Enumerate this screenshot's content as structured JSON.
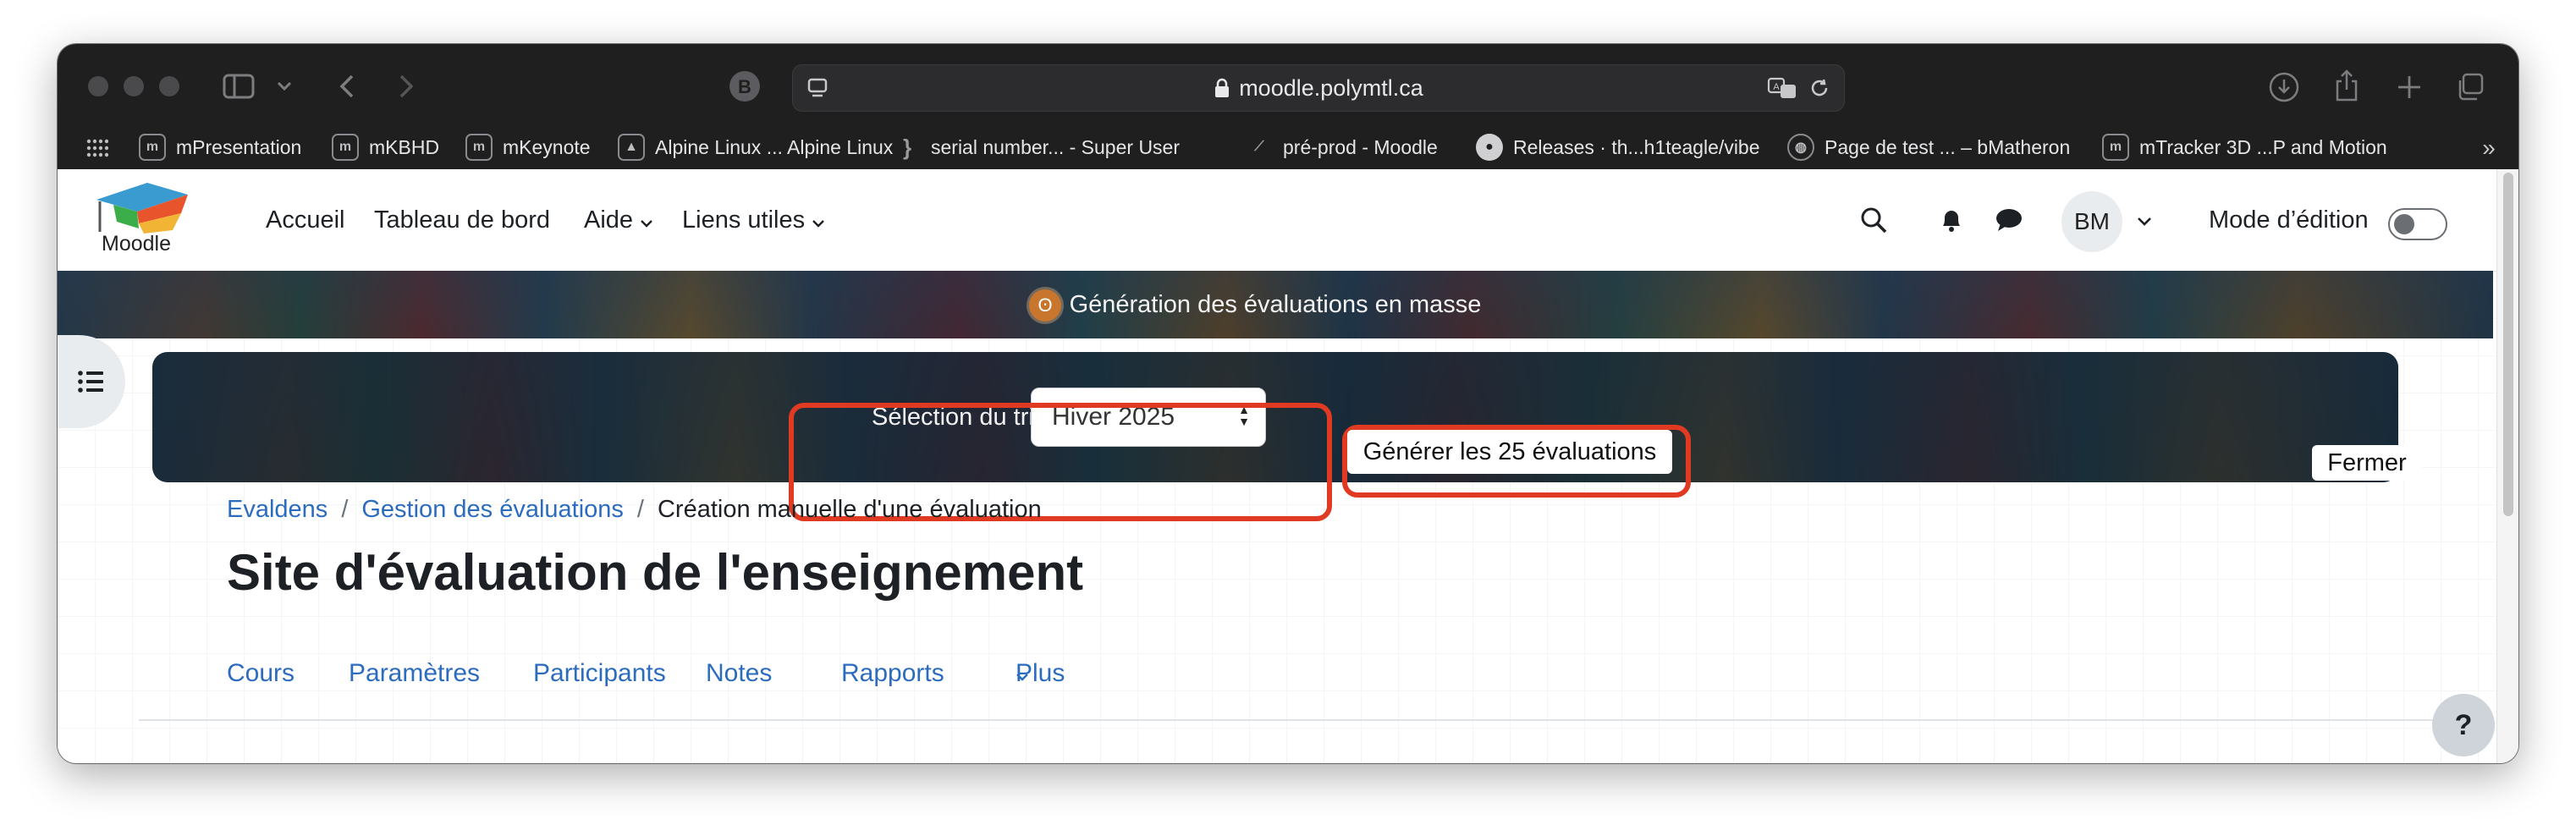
{
  "browser": {
    "url": "moodle.polymtl.ca",
    "bookmarks": [
      {
        "label": "mPresentation",
        "icon": "moodle-icon"
      },
      {
        "label": "mKBHD",
        "icon": "moodle-icon"
      },
      {
        "label": "mKeynote",
        "icon": "moodle-icon"
      },
      {
        "label": "Alpine Linux ... Alpine Linux",
        "icon": "alpine-icon"
      },
      {
        "label": "serial number... - Super User",
        "icon": "superuser-icon"
      },
      {
        "label": "pré-prod - Moodle",
        "icon": "feather-icon"
      },
      {
        "label": "Releases · th...h1teagle/vibe",
        "icon": "github-icon"
      },
      {
        "label": "Page de test ... – bMatheron",
        "icon": "globe-icon"
      },
      {
        "label": "mTracker 3D ...P and Motion",
        "icon": "moodle-icon"
      }
    ]
  },
  "navbar": {
    "logo_text": "Moodle",
    "items": [
      "Accueil",
      "Tableau de bord",
      "Aide",
      "Liens utiles"
    ],
    "avatar_initials": "BM",
    "edit_mode_label": "Mode d’édition"
  },
  "notice": {
    "text": "Génération des évaluations en masse"
  },
  "panel": {
    "trimestre_label": "Sélection du trimestre",
    "trimestre_value": "Hiver 2025",
    "generate_label": "Générer les 25 évaluations",
    "close_label": "Fermer"
  },
  "breadcrumb": {
    "items": [
      "Evaldens",
      "Gestion des évaluations"
    ],
    "current": "Création manuelle d'une évaluation"
  },
  "page_title": "Site d'évaluation de l'enseignement",
  "secondary_nav": [
    "Cours",
    "Paramètres",
    "Participants",
    "Notes",
    "Rapports",
    "Plus"
  ],
  "help_label": "?"
}
